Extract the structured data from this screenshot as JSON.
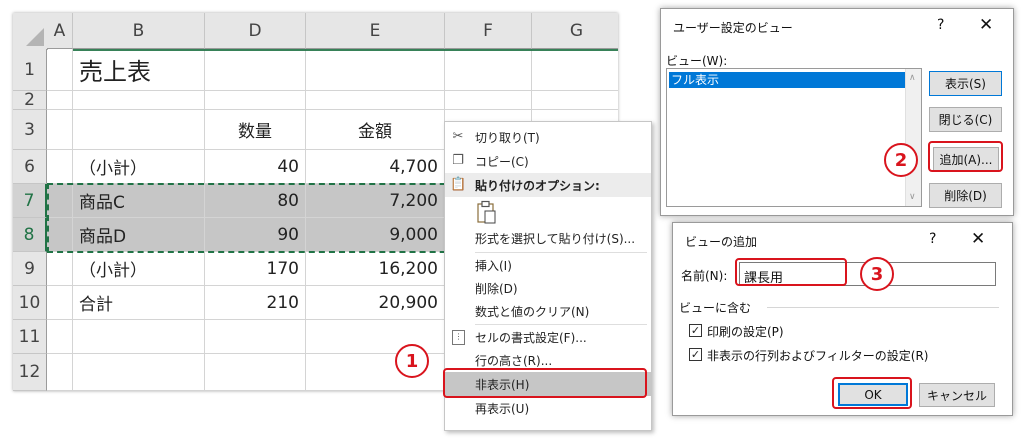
{
  "sheet": {
    "columns": [
      "A",
      "B",
      "D",
      "E",
      "F",
      "G"
    ],
    "rows": [
      "1",
      "2",
      "3",
      "6",
      "7",
      "8",
      "9",
      "10",
      "11",
      "12"
    ],
    "title": "売上表",
    "header_qty": "数量",
    "header_amount": "金額",
    "r6": {
      "label": "（小計）",
      "qty": "40",
      "amount": "4,700"
    },
    "r7": {
      "label": "商品C",
      "qty": "80",
      "amount": "7,200"
    },
    "r8": {
      "label": "商品D",
      "qty": "90",
      "amount": "9,000"
    },
    "r9": {
      "label": "（小計）",
      "qty": "170",
      "amount": "16,200"
    },
    "r10": {
      "label": "合計",
      "qty": "210",
      "amount": "20,900"
    }
  },
  "context_menu": {
    "items": [
      {
        "label": "切り取り(T)",
        "icon": "scissors-icon"
      },
      {
        "label": "コピー(C)",
        "icon": "copy-icon"
      },
      {
        "label": "貼り付けのオプション:",
        "icon": "paste-icon"
      },
      {
        "label": "形式を選択して貼り付け(S)..."
      },
      {
        "label": "挿入(I)"
      },
      {
        "label": "削除(D)"
      },
      {
        "label": "数式と値のクリア(N)"
      },
      {
        "label": "セルの書式設定(F)...",
        "icon": "format-cells-icon"
      },
      {
        "label": "行の高さ(R)..."
      },
      {
        "label": "非表示(H)"
      },
      {
        "label": "再表示(U)"
      }
    ]
  },
  "custom_views_dialog": {
    "title": "ユーザー設定のビュー",
    "help": "?",
    "close": "✕",
    "list_label": "ビュー(W):",
    "views": [
      "フル表示"
    ],
    "buttons": {
      "show": "表示(S)",
      "close": "閉じる(C)",
      "add": "追加(A)...",
      "delete": "削除(D)"
    }
  },
  "add_view_dialog": {
    "title": "ビューの追加",
    "help": "?",
    "close": "✕",
    "name_label": "名前(N):",
    "name_value": "課長用",
    "group_label": "ビューに含む",
    "option_print": "印刷の設定(P)",
    "option_hidden": "非表示の行列およびフィルターの設定(R)",
    "ok": "OK",
    "cancel": "キャンセル"
  },
  "steps": [
    "1",
    "2",
    "3"
  ],
  "colors": {
    "excel_green": "#217346",
    "callout_red": "#d9141d",
    "selection_gray": "#c6c6c6"
  }
}
